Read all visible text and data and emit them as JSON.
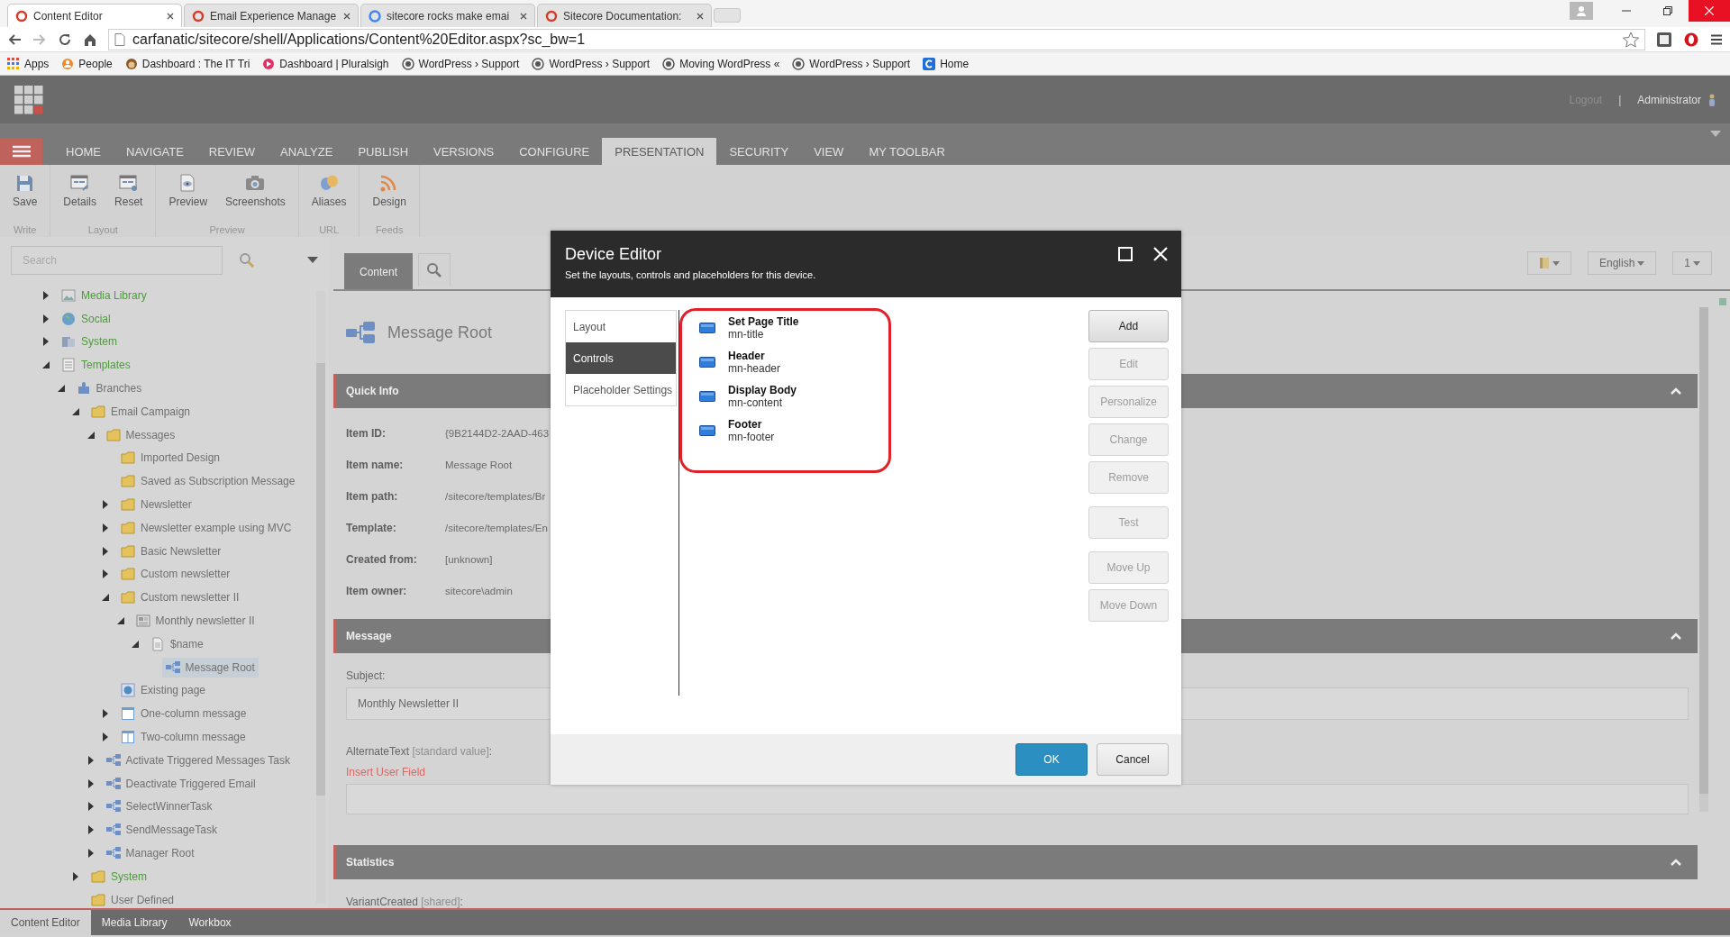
{
  "browser": {
    "tabs": [
      {
        "title": "Content Editor",
        "selected": true
      },
      {
        "title": "Email Experience Manage",
        "selected": false
      },
      {
        "title": "sitecore rocks make emai",
        "selected": false
      },
      {
        "title": "Sitecore Documentation:",
        "selected": false
      }
    ],
    "url": "carfanatic/sitecore/shell/Applications/Content%20Editor.aspx?sc_bw=1",
    "bookmarks": [
      {
        "label": "Apps",
        "kind": "apps"
      },
      {
        "label": "People",
        "kind": "people"
      },
      {
        "label": "Dashboard : The IT Tri",
        "kind": "monkey"
      },
      {
        "label": "Dashboard | Pluralsigh",
        "kind": "play"
      },
      {
        "label": "WordPress › Support",
        "kind": "wp"
      },
      {
        "label": "WordPress › Support",
        "kind": "wp"
      },
      {
        "label": "Moving WordPress «",
        "kind": "wp"
      },
      {
        "label": "WordPress › Support",
        "kind": "wp"
      },
      {
        "label": "Home",
        "kind": "home"
      }
    ]
  },
  "header": {
    "logout": "Logout",
    "separator": "|",
    "user": "Administrator"
  },
  "ribbon": {
    "tabs": [
      {
        "label": "HOME",
        "selected": false
      },
      {
        "label": "NAVIGATE",
        "selected": false
      },
      {
        "label": "REVIEW",
        "selected": false
      },
      {
        "label": "ANALYZE",
        "selected": false
      },
      {
        "label": "PUBLISH",
        "selected": false
      },
      {
        "label": "VERSIONS",
        "selected": false
      },
      {
        "label": "CONFIGURE",
        "selected": false
      },
      {
        "label": "PRESENTATION",
        "selected": true
      },
      {
        "label": "SECURITY",
        "selected": false
      },
      {
        "label": "VIEW",
        "selected": false
      },
      {
        "label": "MY TOOLBAR",
        "selected": false
      }
    ],
    "groups": [
      {
        "title": "Write",
        "buttons": [
          {
            "label": "Save",
            "kind": "save"
          }
        ]
      },
      {
        "title": "Layout",
        "buttons": [
          {
            "label": "Details",
            "kind": "details"
          },
          {
            "label": "Reset",
            "kind": "reset"
          }
        ]
      },
      {
        "title": "Preview",
        "buttons": [
          {
            "label": "Preview",
            "kind": "preview"
          },
          {
            "label": "Screenshots",
            "kind": "camera"
          }
        ]
      },
      {
        "title": "URL",
        "buttons": [
          {
            "label": "Aliases",
            "kind": "masks"
          }
        ]
      },
      {
        "title": "Feeds",
        "buttons": [
          {
            "label": "Design",
            "kind": "rss"
          }
        ]
      }
    ]
  },
  "tree": {
    "search_placeholder": "Search",
    "items": [
      {
        "label": "Media Library",
        "kind": "media",
        "expanded": false,
        "color": "#4e9a3c",
        "selected": false
      },
      {
        "label": "Social",
        "kind": "globe",
        "expanded": false,
        "color": "#4e9a3c",
        "selected": false
      },
      {
        "label": "System",
        "kind": "system",
        "expanded": false,
        "color": "#4e9a3c",
        "selected": false
      },
      {
        "label": "Templates",
        "kind": "list",
        "expanded": true,
        "color": "#4e9a3c",
        "selected": false,
        "children": [
          {
            "label": "Branches",
            "kind": "puzzle",
            "expanded": true,
            "color": "#707070",
            "selected": false,
            "children": [
              {
                "label": "Email Campaign",
                "kind": "folder",
                "expanded": true,
                "color": "#707070",
                "selected": false,
                "children": [
                  {
                    "label": "Messages",
                    "kind": "folder",
                    "expanded": true,
                    "color": "#707070",
                    "selected": false,
                    "children": [
                      {
                        "label": "Imported Design",
                        "kind": "folder",
                        "color": "#707070",
                        "selected": false
                      },
                      {
                        "label": "Saved as Subscription Message",
                        "kind": "folder",
                        "color": "#707070",
                        "selected": false
                      },
                      {
                        "label": "Newsletter",
                        "kind": "folder",
                        "expanded": false,
                        "color": "#707070",
                        "selected": false
                      },
                      {
                        "label": "Newsletter example using MVC",
                        "kind": "folder",
                        "expanded": false,
                        "color": "#707070",
                        "selected": false
                      },
                      {
                        "label": "Basic Newsletter",
                        "kind": "folder",
                        "expanded": false,
                        "color": "#707070",
                        "selected": false
                      },
                      {
                        "label": "Custom newsletter",
                        "kind": "folder",
                        "expanded": false,
                        "color": "#707070",
                        "selected": false
                      },
                      {
                        "label": "Custom newsletter II",
                        "kind": "folder",
                        "expanded": true,
                        "color": "#707070",
                        "selected": false,
                        "children": [
                          {
                            "label": "Monthly newsletter II",
                            "kind": "newspaper",
                            "expanded": true,
                            "color": "#707070",
                            "selected": false,
                            "children": [
                              {
                                "label": "$name",
                                "kind": "doc",
                                "expanded": true,
                                "color": "#707070",
                                "selected": false,
                                "children": [
                                  {
                                    "label": "Message Root",
                                    "kind": "flow",
                                    "color": "#707070",
                                    "selected": true
                                  }
                                ]
                              }
                            ]
                          }
                        ]
                      },
                      {
                        "label": "Existing page",
                        "kind": "page",
                        "color": "#707070",
                        "selected": false
                      },
                      {
                        "label": "One-column message",
                        "kind": "onecol",
                        "expanded": false,
                        "color": "#707070",
                        "selected": false
                      },
                      {
                        "label": "Two-column message",
                        "kind": "twocol",
                        "expanded": false,
                        "color": "#707070",
                        "selected": false
                      }
                    ]
                  },
                  {
                    "label": "Activate Triggered Messages Task",
                    "kind": "flow",
                    "expanded": false,
                    "color": "#707070",
                    "selected": false
                  },
                  {
                    "label": "Deactivate Triggered Email",
                    "kind": "flow",
                    "expanded": false,
                    "color": "#707070",
                    "selected": false
                  },
                  {
                    "label": "SelectWinnerTask",
                    "kind": "flow",
                    "expanded": false,
                    "color": "#707070",
                    "selected": false
                  },
                  {
                    "label": "SendMessageTask",
                    "kind": "flow",
                    "expanded": false,
                    "color": "#707070",
                    "selected": false
                  },
                  {
                    "label": "Manager Root",
                    "kind": "flow",
                    "expanded": false,
                    "color": "#707070",
                    "selected": false
                  }
                ]
              },
              {
                "label": "System",
                "kind": "folder",
                "expanded": false,
                "color": "#4e9a3c",
                "selected": false
              },
              {
                "label": "User Defined",
                "kind": "folder",
                "color": "#707070",
                "selected": false
              }
            ]
          }
        ]
      }
    ]
  },
  "content": {
    "tabs": [
      {
        "label": "Content",
        "kind": "text",
        "selected": true
      },
      {
        "kind": "search",
        "selected": false
      }
    ],
    "toolbar": [
      {
        "kind": "icon"
      },
      {
        "kind": "text",
        "label": "English"
      },
      {
        "kind": "text",
        "label": "1"
      }
    ],
    "item_title": "Message Root",
    "sections": [
      {
        "title": "Quick Info",
        "fields": [
          {
            "kind": "info",
            "label": "Item ID:",
            "value": "{9B2144D2-2AAD-463"
          },
          {
            "kind": "info",
            "label": "Item name:",
            "value": "Message Root"
          },
          {
            "kind": "info",
            "label": "Item path:",
            "value": "/sitecore/templates/Br"
          },
          {
            "kind": "info",
            "label": "Template:",
            "value": "/sitecore/templates/En"
          },
          {
            "kind": "info",
            "label": "Created from:",
            "value": "[unknown]"
          },
          {
            "kind": "info",
            "label": "Item owner:",
            "value": "sitecore\\admin"
          }
        ]
      },
      {
        "title": "Message",
        "fields": [
          {
            "kind": "input",
            "label": "Subject:",
            "value": "Monthly Newsletter II"
          },
          {
            "kind": "memo",
            "label": "AlternateText",
            "note": "[standard value]",
            "suffix": ":",
            "link": "Insert User Field"
          }
        ]
      },
      {
        "title": "Statistics",
        "fields": [
          {
            "kind": "label",
            "label": "VariantCreated",
            "note": "[shared]",
            "suffix": ":"
          }
        ]
      }
    ]
  },
  "dialog": {
    "title": "Device Editor",
    "subtitle": "Set the layouts, controls and placeholders for this device.",
    "nav": [
      {
        "label": "Layout",
        "selected": false
      },
      {
        "label": "Controls",
        "selected": true
      },
      {
        "label": "Placeholder Settings",
        "selected": false
      }
    ],
    "controls": [
      {
        "name": "Set Page Title",
        "placeholder": "mn-title"
      },
      {
        "name": "Header",
        "placeholder": "mn-header"
      },
      {
        "name": "Display Body",
        "placeholder": "mn-content"
      },
      {
        "name": "Footer",
        "placeholder": "mn-footer"
      }
    ],
    "actions": [
      {
        "label": "Add",
        "disabled": false
      },
      {
        "label": "Edit",
        "disabled": true
      },
      {
        "label": "Personalize",
        "disabled": true
      },
      {
        "label": "Change",
        "disabled": true
      },
      {
        "label": "Remove",
        "disabled": true
      },
      {
        "label": "Test",
        "disabled": true
      },
      {
        "label": "Move Up",
        "disabled": true
      },
      {
        "label": "Move Down",
        "disabled": true
      }
    ],
    "footer": [
      {
        "label": "OK",
        "kind": "primary"
      },
      {
        "label": "Cancel",
        "kind": "default"
      }
    ]
  },
  "taskbar": [
    {
      "label": "Content Editor",
      "selected": true
    },
    {
      "label": "Media Library",
      "selected": false
    },
    {
      "label": "Workbox",
      "selected": false
    }
  ]
}
